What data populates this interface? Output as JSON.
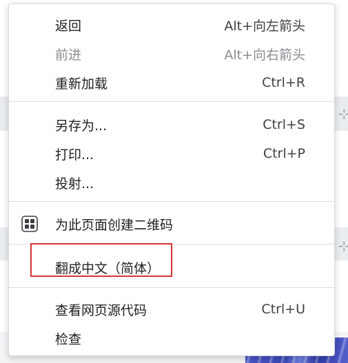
{
  "menu": {
    "back": {
      "label": "返回",
      "shortcut": "Alt+向左箭头"
    },
    "forward": {
      "label": "前进",
      "shortcut": "Alt+向右箭头"
    },
    "reload": {
      "label": "重新加载",
      "shortcut": "Ctrl+R"
    },
    "save_as": {
      "label": "另存为...",
      "shortcut": "Ctrl+S"
    },
    "print": {
      "label": "打印...",
      "shortcut": "Ctrl+P"
    },
    "cast": {
      "label": "投射..."
    },
    "qr_code": {
      "label": "为此页面创建二维码",
      "icon": "qr-code-icon"
    },
    "translate": {
      "label": "翻成中文（简体）"
    },
    "view_source": {
      "label": "查看网页源代码",
      "shortcut": "Ctrl+U"
    },
    "inspect": {
      "label": "检查"
    }
  },
  "colors": {
    "highlight_border": "#d9303a",
    "disabled_text": "#8a8d91",
    "menu_text": "#202124"
  }
}
